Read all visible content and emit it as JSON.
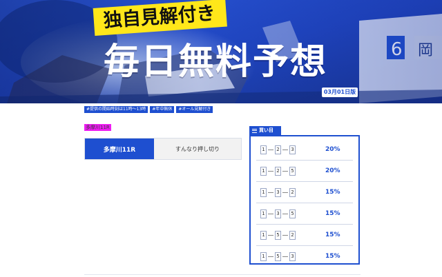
{
  "hero": {
    "badge": "独自見解付き",
    "title": "毎日無料予想",
    "date": "03月01日版"
  },
  "tags": [
    "#提供の開始時刻は11時〜13時",
    "#年中無休",
    "#オール見解付き"
  ],
  "race_name_label": "多摩川11R",
  "race": {
    "tab_label": "多摩川11R",
    "description": "すんなり押し切り"
  },
  "bets": {
    "header": "買い目",
    "rows": [
      {
        "n1": "1",
        "n2": "2",
        "n3": "3",
        "pct": "20%"
      },
      {
        "n1": "1",
        "n2": "2",
        "n3": "5",
        "pct": "20%"
      },
      {
        "n1": "1",
        "n2": "3",
        "n3": "2",
        "pct": "15%"
      },
      {
        "n1": "1",
        "n2": "3",
        "n3": "5",
        "pct": "15%"
      },
      {
        "n1": "1",
        "n2": "5",
        "n3": "2",
        "pct": "15%"
      },
      {
        "n1": "1",
        "n2": "5",
        "n3": "3",
        "pct": "15%"
      }
    ]
  },
  "colors": {
    "accent": "#1e4fd0",
    "badge_yellow": "#ffe71a",
    "highlight": "#ee1cf2"
  }
}
